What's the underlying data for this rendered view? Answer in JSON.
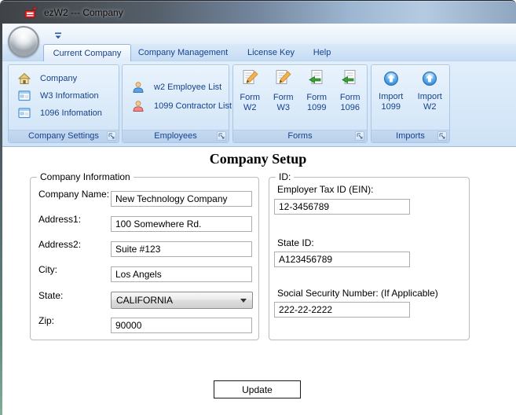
{
  "window": {
    "title": "ezW2 --- Company"
  },
  "tabs": [
    {
      "label": "Current Company",
      "selected": true
    },
    {
      "label": "Company Management",
      "selected": false
    },
    {
      "label": "License Key",
      "selected": false
    },
    {
      "label": "Help",
      "selected": false
    }
  ],
  "ribbon": {
    "groups": [
      {
        "label": "Company Settings",
        "items": [
          "Company",
          "W3 Information",
          "1096 Infomation"
        ]
      },
      {
        "label": "Employees",
        "items": [
          "w2 Employee List",
          "1099 Contractor List"
        ]
      },
      {
        "label": "Forms",
        "items": [
          [
            "Form",
            "W2"
          ],
          [
            "Form",
            "W3"
          ],
          [
            "Form",
            "1099"
          ],
          [
            "Form",
            "1096"
          ]
        ]
      },
      {
        "label": "Imports",
        "items": [
          [
            "Import",
            "1099"
          ],
          [
            "Import",
            "W2"
          ]
        ]
      }
    ]
  },
  "content": {
    "heading": "Company Setup",
    "company_info": {
      "legend": "Company Information",
      "fields": [
        {
          "label": "Company Name:",
          "value": "New Technology Company",
          "type": "text"
        },
        {
          "label": "Address1:",
          "value": "100 Somewhere Rd.",
          "type": "text"
        },
        {
          "label": "Address2:",
          "value": "Suite #123",
          "type": "text"
        },
        {
          "label": "City:",
          "value": "Los Angels",
          "type": "text"
        },
        {
          "label": "State:",
          "value": "CALIFORNIA",
          "type": "select"
        },
        {
          "label": "Zip:",
          "value": "90000",
          "type": "text"
        }
      ]
    },
    "id_section": {
      "legend": "ID:",
      "fields": [
        {
          "label": "Employer Tax ID (EIN):",
          "value": "12-3456789"
        },
        {
          "label": "State ID:",
          "value": "A123456789"
        },
        {
          "label": "Social Security Number: (If Applicable)",
          "value": "222-22-2222"
        }
      ]
    },
    "update_button": "Update"
  },
  "colors": {
    "accent_text": "#15428b",
    "titlebar_dark": "#45494e",
    "ribbon_bg": "#d9e8f8",
    "content_bg": "#ffffff",
    "app_icon_red": "#d92b2b"
  }
}
